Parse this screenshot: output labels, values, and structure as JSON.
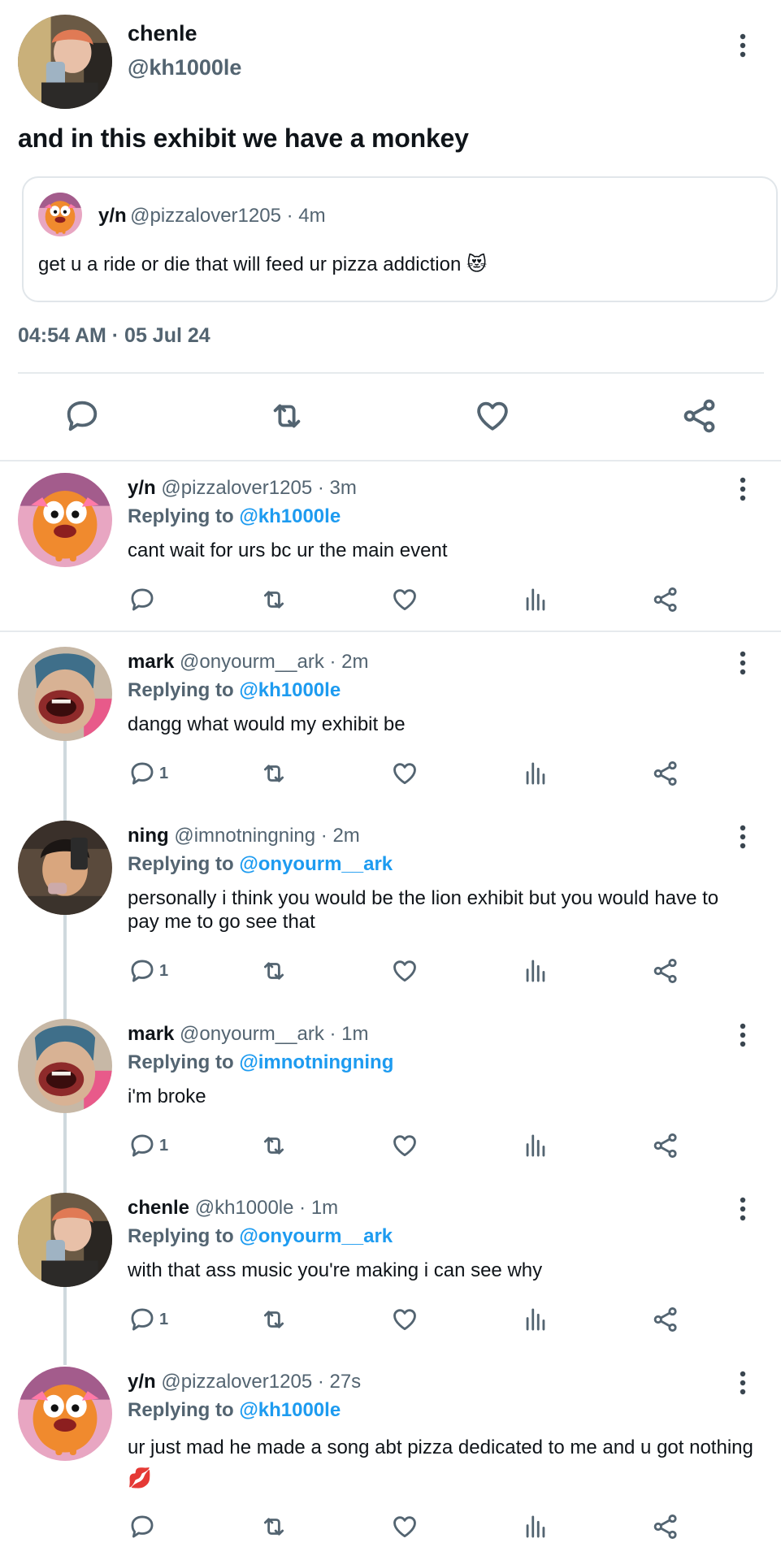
{
  "main_tweet": {
    "name": "chenle",
    "handle": "@kh1000le",
    "text": "and in this exhibit we have a monkey",
    "quote": {
      "name": "y/n",
      "meta": "@pizzalover1205 · 4m",
      "text": "get u a ride or die that will feed ur pizza addiction 😻"
    },
    "timestamp": "04:54 AM · 05 Jul 24"
  },
  "replying_label": "Replying to",
  "replies": [
    {
      "name": "y/n",
      "meta": "@pizzalover1205 · 3m",
      "mention": "@kh1000le",
      "text": "cant wait for urs bc ur the main event",
      "reply_count": ""
    },
    {
      "name": "mark",
      "meta": "@onyourm__ark · 2m",
      "mention": "@kh1000le",
      "text": "dangg what would my exhibit be",
      "reply_count": "1"
    },
    {
      "name": "ning",
      "meta": "@imnotningning · 2m",
      "mention": "@onyourm__ark",
      "text": "personally i think you would be the lion exhibit but you would have to pay me to go see that",
      "reply_count": "1"
    },
    {
      "name": "mark",
      "meta": "@onyourm__ark · 1m",
      "mention": "@imnotningning",
      "text": "i'm broke",
      "reply_count": "1"
    },
    {
      "name": "chenle",
      "meta": "@kh1000le · 1m",
      "mention": "@onyourm__ark",
      "text": "with that ass music you're making i can see why",
      "reply_count": "1"
    },
    {
      "name": "y/n",
      "meta": "@pizzalover1205 · 27s",
      "mention": "@kh1000le",
      "text": "ur just mad he made a song abt pizza dedicated to me and u got nothing 💋",
      "reply_count": ""
    }
  ],
  "colors": {
    "accent": "#1d9bf0",
    "text": "#0f1419",
    "secondary": "#536471",
    "divider": "#e6eaed"
  },
  "icons": [
    "more-icon",
    "reply-icon",
    "retweet-icon",
    "like-icon",
    "views-icon",
    "share-icon"
  ]
}
